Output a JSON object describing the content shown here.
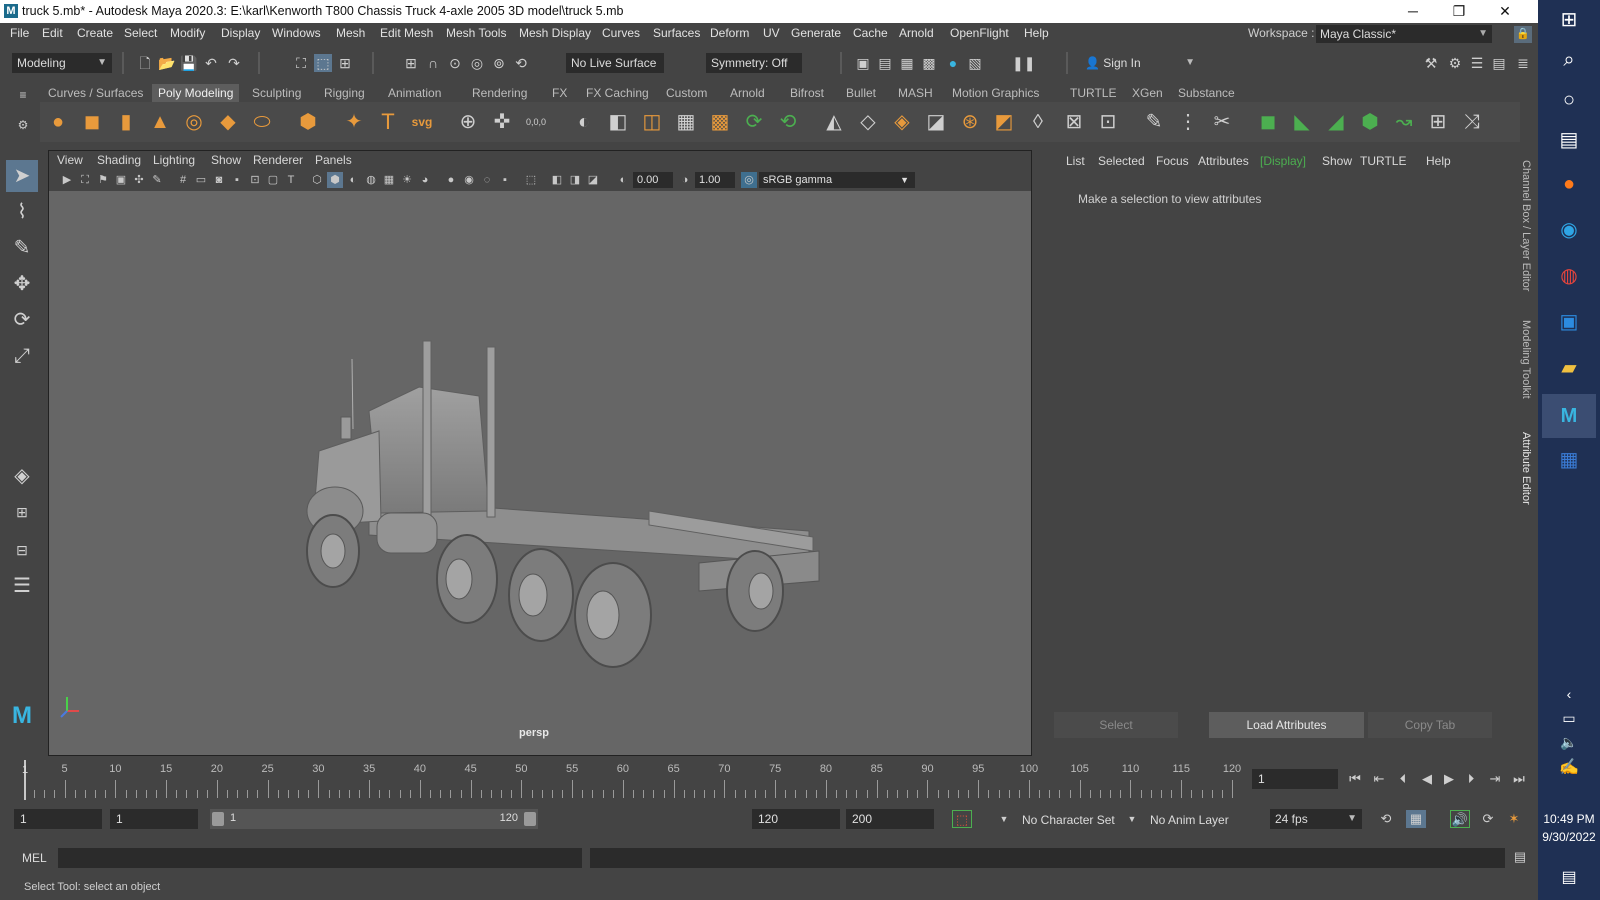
{
  "window": {
    "title": "truck 5.mb* - Autodesk Maya 2020.3: E:\\karl\\Kenworth T800 Chassis Truck 4-axle 2005 3D model\\truck 5.mb",
    "minimize": "─",
    "restore": "❐",
    "close": "✕"
  },
  "menubar": {
    "items": [
      "File",
      "Edit",
      "Create",
      "Select",
      "Modify",
      "Display",
      "Windows",
      "Mesh",
      "Edit Mesh",
      "Mesh Tools",
      "Mesh Display",
      "Curves",
      "Surfaces",
      "Deform",
      "UV",
      "Generate",
      "Cache",
      "Arnold",
      "OpenFlight",
      "Help"
    ],
    "workspace_label": "Workspace :",
    "workspace_value": "Maya Classic*"
  },
  "statusline": {
    "menuset": "Modeling",
    "live_surface": "No Live Surface",
    "symmetry": "Symmetry: Off",
    "sign_in": "Sign In"
  },
  "shelf": {
    "tabs": [
      "Curves / Surfaces",
      "Poly Modeling",
      "Sculpting",
      "Rigging",
      "Animation",
      "Rendering",
      "FX",
      "FX Caching",
      "Custom",
      "Arnold",
      "Bifrost",
      "Bullet",
      "MASH",
      "Motion Graphics",
      "TURTLE",
      "XGen",
      "Substance"
    ],
    "active_tab": "Poly Modeling",
    "text_icon": "T",
    "svg_icon": "svg",
    "coords_icon": "0,0,0"
  },
  "viewport": {
    "menu": [
      "View",
      "Shading",
      "Lighting",
      "Show",
      "Renderer",
      "Panels"
    ],
    "exposure": "0.00",
    "gamma": "1.00",
    "color_space": "sRGB gamma",
    "camera_label": "persp"
  },
  "attribute_editor": {
    "menu": [
      "List",
      "Selected",
      "Focus",
      "Attributes",
      "[Display]",
      "Show",
      "TURTLE",
      "Help"
    ],
    "message": "Make a selection to view attributes",
    "select_button": "Select",
    "load_button": "Load Attributes",
    "copy_tab_button": "Copy Tab"
  },
  "side_tabs": [
    "Channel Box / Layer Editor",
    "Modeling Toolkit",
    "Attribute Editor"
  ],
  "timeline": {
    "labels": [
      "5",
      "10",
      "15",
      "20",
      "25",
      "30",
      "35",
      "40",
      "45",
      "50",
      "55",
      "60",
      "65",
      "70",
      "75",
      "80",
      "85",
      "90",
      "95",
      "100",
      "105",
      "110",
      "115",
      "120"
    ],
    "min": 1,
    "max": 120,
    "current_frame": 1,
    "current_frame_field": "1"
  },
  "range": {
    "start_field": "1",
    "playback_start": "1",
    "range_start_label": "1",
    "range_end_label": "120",
    "playback_end": "120",
    "end_field": "200",
    "character_set": "No Character Set",
    "anim_layer": "No Anim Layer",
    "fps": "24 fps"
  },
  "command": {
    "mel_label": "MEL"
  },
  "help_line": "Select Tool: select an object",
  "taskbar": {
    "time": "10:49 PM",
    "date": "9/30/2022"
  },
  "colors": {
    "accent_green": "#4caf50",
    "selection_blue": "#5c7790",
    "taskbar_bg": "#1f3054"
  }
}
